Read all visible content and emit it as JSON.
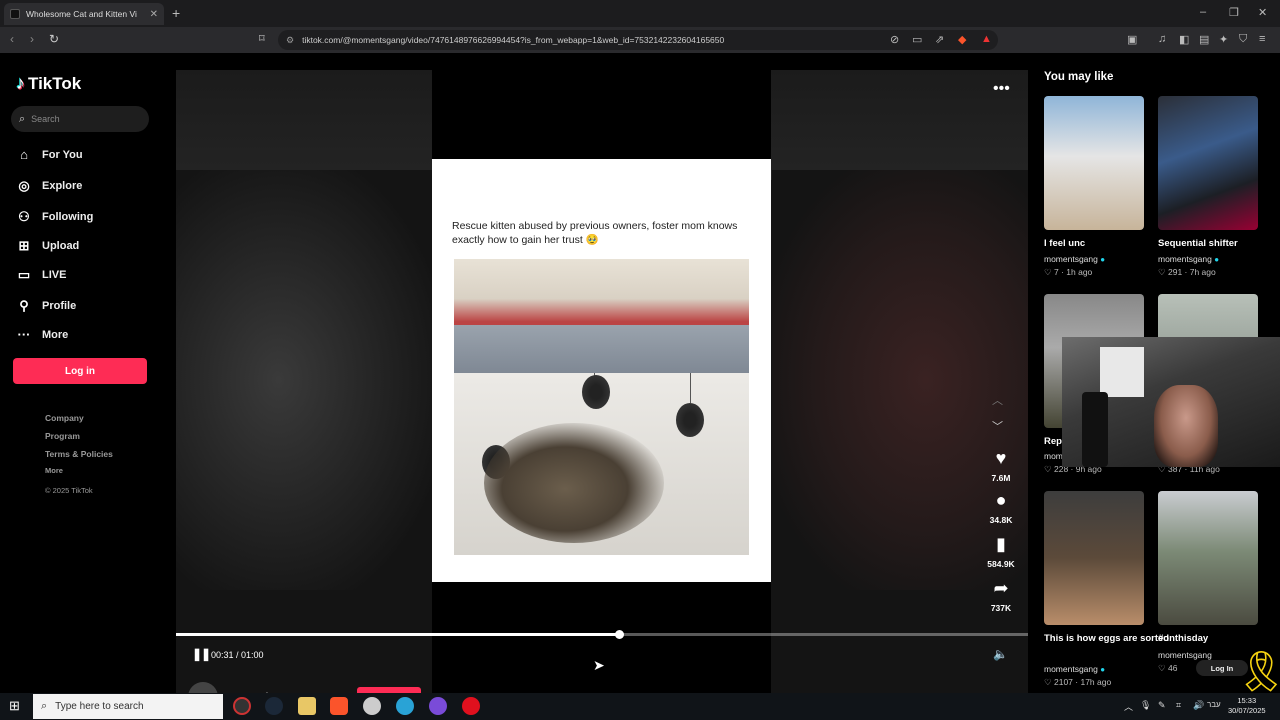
{
  "browser": {
    "tab_title": "Wholesome Cat and Kitten Vi",
    "new_tab": "+",
    "url": "tiktok.com/@momentsgang/video/7476148976626994454?is_from_webapp=1&web_id=7532142232604165650",
    "window_controls": {
      "minimize": "–",
      "restore": "❐",
      "close": "✕"
    }
  },
  "sidebar": {
    "logo": "TikTok",
    "search_placeholder": "Search",
    "items": [
      {
        "label": "For You",
        "icon": "home-icon"
      },
      {
        "label": "Explore",
        "icon": "compass-icon"
      },
      {
        "label": "Following",
        "icon": "following-icon"
      },
      {
        "label": "Upload",
        "icon": "upload-icon"
      },
      {
        "label": "LIVE",
        "icon": "live-icon"
      },
      {
        "label": "Profile",
        "icon": "profile-icon"
      },
      {
        "label": "More",
        "icon": "more-icon"
      }
    ],
    "login": "Log in",
    "footer": {
      "company": "Company",
      "program": "Program",
      "terms": "Terms & Policies",
      "more": "More",
      "copyright": "© 2025 TikTok"
    }
  },
  "video": {
    "caption": "Rescue kitten abused by previous owners, foster mom knows exactly how to gain her trust 🥹",
    "likes": "7.6M",
    "comments": "34.8K",
    "saves": "584.9K",
    "shares": "737K",
    "time": "00:31 / 01:00",
    "progress_fraction": 0.52,
    "author": "momentsgang"
  },
  "recommended": {
    "title": "You may like",
    "videos": [
      {
        "title": "I feel unc",
        "user": "momentsgang",
        "likes": "7",
        "age": "1h ago"
      },
      {
        "title": "Sequential shifter",
        "user": "momentsgang",
        "likes": "291",
        "age": "7h ago"
      },
      {
        "title": "Rep",
        "user": "mom",
        "likes": "228",
        "age": "9h ago"
      },
      {
        "title": "",
        "user": "",
        "likes": "387",
        "age": "11h ago"
      },
      {
        "title": "This is how eggs are sorted",
        "user": "momentsgang",
        "likes": "2107",
        "age": "17h ago"
      },
      {
        "title": "#onthisday",
        "user": "momentsgang",
        "likes": "46",
        "age": ""
      }
    ],
    "login_pill": "Log In"
  },
  "taskbar": {
    "search_placeholder": "Type here to search",
    "lang": "עבר",
    "time": "15:33",
    "date": "30/07/2025"
  }
}
